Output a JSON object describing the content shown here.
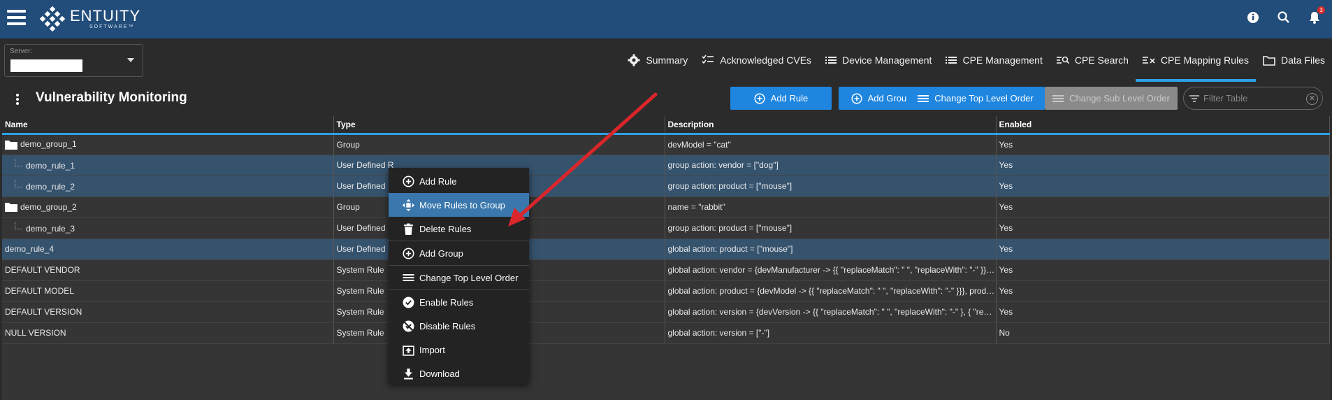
{
  "header": {
    "logo_name": "ENTUITY",
    "logo_sub": "SOFTWARE™",
    "notifications_count": "3",
    "colors": {
      "bar": "#224d7a",
      "accent": "#2e9fe6",
      "button": "#1f86e0"
    }
  },
  "server": {
    "label": "Server:",
    "value": ""
  },
  "nav": {
    "tabs": [
      {
        "label": "Summary",
        "icon": "gear-icon"
      },
      {
        "label": "Acknowledged CVEs",
        "icon": "checklist-icon"
      },
      {
        "label": "Device Management",
        "icon": "list-icon"
      },
      {
        "label": "CPE Management",
        "icon": "list-icon"
      },
      {
        "label": "CPE Search",
        "icon": "search-list-icon"
      },
      {
        "label": "CPE Mapping Rules",
        "icon": "mapping-icon",
        "active": true
      },
      {
        "label": "Data Files",
        "icon": "folder-icon"
      }
    ]
  },
  "page": {
    "title": "Vulnerability Monitoring"
  },
  "toolbar": {
    "add_rule": "Add Rule",
    "add_group": "Add Group",
    "change_top": "Change Top Level Order",
    "change_sub": "Change Sub Level Order",
    "filter_placeholder": "Filter Table"
  },
  "table": {
    "columns": [
      "Name",
      "Type",
      "Description",
      "Enabled"
    ],
    "rows": [
      {
        "name": "demo_group_1",
        "type": "Group",
        "description": "devModel = \"cat\"",
        "enabled": "Yes"
      },
      {
        "name": "demo_rule_1",
        "type": "User Defined R",
        "description": "group action: vendor = [\"dog\"]",
        "enabled": "Yes"
      },
      {
        "name": "demo_rule_2",
        "type": "User Defined",
        "description": "group action: product = [\"mouse\"]",
        "enabled": "Yes"
      },
      {
        "name": "demo_group_2",
        "type": "Group",
        "description": "name = \"rabbit\"",
        "enabled": "Yes"
      },
      {
        "name": "demo_rule_3",
        "type": "User Defined",
        "description": "group action: product = [\"mouse\"]",
        "enabled": "Yes"
      },
      {
        "name": "demo_rule_4",
        "type": "User Defined",
        "description": "global action: product = [\"mouse\"]",
        "enabled": "Yes"
      },
      {
        "name": "DEFAULT VENDOR",
        "type": "System Rule",
        "description": "global action: vendor = {devManufacturer -> {{ \"replaceMatch\": \" \", \"replaceWith\": \"-\" }}}, ...",
        "enabled": "Yes"
      },
      {
        "name": "DEFAULT MODEL",
        "type": "System Rule",
        "description": "global action: product = {devModel -> {{ \"replaceMatch\": \" \", \"replaceWith\": \"-\" }}}, produ...",
        "enabled": "Yes"
      },
      {
        "name": "DEFAULT VERSION",
        "type": "System Rule",
        "description": "global action: version = {devVersion -> {{ \"replaceMatch\": \" \", \"replaceWith\": \"-\" }, { \"repla...",
        "enabled": "Yes"
      },
      {
        "name": "NULL VERSION",
        "type": "System Rule",
        "description": "global action: version = [\"-\"]",
        "enabled": "No"
      }
    ]
  },
  "context_menu": {
    "items": [
      {
        "label": "Add Rule",
        "icon": "add-circle-icon"
      },
      {
        "label": "Move Rules to Group",
        "icon": "move-icon",
        "highlighted": true
      },
      {
        "label": "Delete Rules",
        "icon": "trash-icon"
      },
      {
        "label": "Add Group",
        "icon": "add-circle-icon"
      },
      {
        "label": "Change Top Level Order",
        "icon": "list-icon"
      },
      {
        "label": "Enable Rules",
        "icon": "check-circle-icon"
      },
      {
        "label": "Disable Rules",
        "icon": "disable-icon"
      },
      {
        "label": "Import",
        "icon": "import-icon"
      },
      {
        "label": "Download",
        "icon": "download-icon"
      }
    ]
  },
  "annotation": {
    "arrow_color": "#d9262b"
  }
}
